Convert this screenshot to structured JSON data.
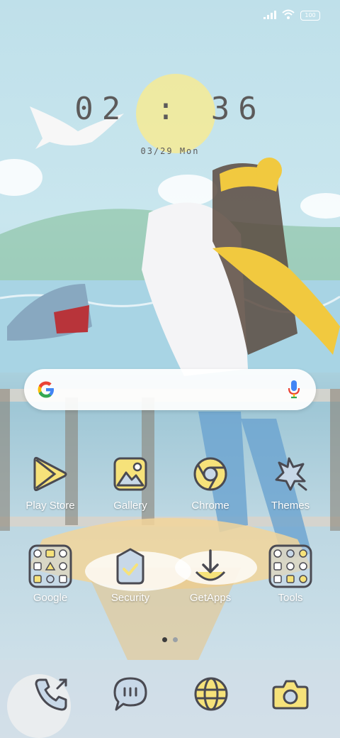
{
  "status_bar": {
    "battery": "100",
    "signal_icon": "signal-icon",
    "wifi_icon": "wifi-icon"
  },
  "clock": {
    "time": "02 : 36",
    "date": "03/29 Mon"
  },
  "search_bar": {
    "google_icon": "google-logo-icon",
    "mic_icon": "mic-icon"
  },
  "apps_row1": [
    {
      "label": "Play Store",
      "icon": "play-store-icon"
    },
    {
      "label": "Gallery",
      "icon": "gallery-icon"
    },
    {
      "label": "Chrome",
      "icon": "chrome-icon"
    },
    {
      "label": "Themes",
      "icon": "themes-icon"
    }
  ],
  "apps_row2": [
    {
      "label": "Google",
      "icon": "google-folder-icon"
    },
    {
      "label": "Security",
      "icon": "security-icon"
    },
    {
      "label": "GetApps",
      "icon": "getapps-icon"
    },
    {
      "label": "Tools",
      "icon": "tools-folder-icon"
    }
  ],
  "page_indicator": {
    "pages": 2,
    "current": 1
  },
  "dock": [
    {
      "icon": "phone-icon"
    },
    {
      "icon": "messages-icon"
    },
    {
      "icon": "browser-icon"
    },
    {
      "icon": "camera-icon"
    }
  ],
  "colors": {
    "accent_yellow": "#f6e27a",
    "icon_stroke": "#4a4a52",
    "icon_fill": "#c8d8e8"
  }
}
